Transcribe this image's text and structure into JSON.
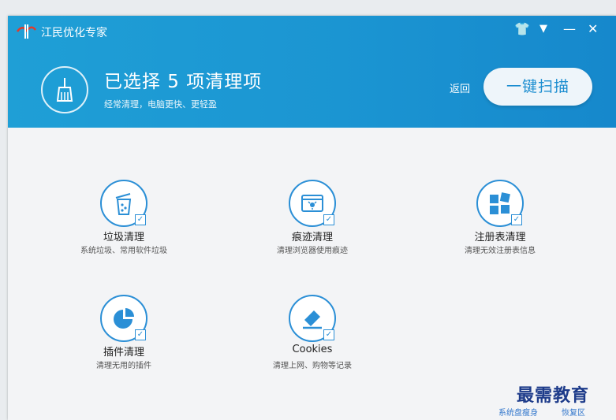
{
  "app": {
    "title": "江民优化专家"
  },
  "window_controls": {
    "skin": "👕",
    "menu": "▼",
    "minimize": "—",
    "close": "✕"
  },
  "banner": {
    "headline": "已选择 5 项清理项",
    "subline": "经常清理，电脑更快、更轻盈",
    "back_label": "返回",
    "scan_label": "一键扫描"
  },
  "items": [
    {
      "title": "垃圾清理",
      "desc": "系统垃圾、常用软件垃圾",
      "icon": "trash-bin-icon",
      "checked": true
    },
    {
      "title": "痕迹清理",
      "desc": "清理浏览器使用痕迹",
      "icon": "browser-trace-icon",
      "checked": true
    },
    {
      "title": "注册表清理",
      "desc": "清理无效注册表信息",
      "icon": "registry-blocks-icon",
      "checked": true
    },
    {
      "title": "插件清理",
      "desc": "清理无用的插件",
      "icon": "plugin-pie-icon",
      "checked": true
    },
    {
      "title": "Cookies",
      "desc": "清理上网、购物等记录",
      "icon": "eraser-icon",
      "checked": true
    }
  ],
  "footer": {
    "link1": "系统盘瘦身",
    "link2": "恢复区"
  },
  "watermark": "最需教育",
  "colors": {
    "header": "#1b95d2",
    "accent": "#2b8fd6",
    "page": "#f3f4f6"
  }
}
